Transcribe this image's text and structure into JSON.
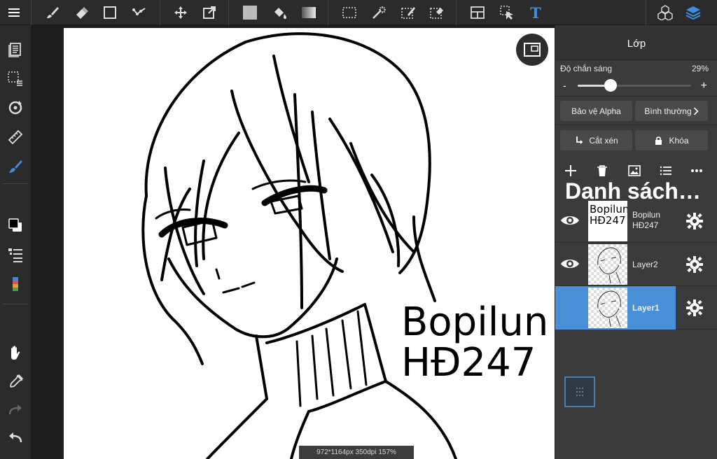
{
  "canvas": {
    "text_lines": [
      "Bopilun",
      "HĐ247"
    ],
    "status": "972*1164px 350dpi 157%"
  },
  "panel": {
    "title": "Lớp",
    "opacity_label": "Độ chắn sáng",
    "opacity_value": "29%",
    "opacity_fraction": 0.29,
    "slider_minus": "-",
    "slider_plus": "+",
    "alpha_lock_label": "Bảo vệ Alpha",
    "blend_mode_label": "Bình thường",
    "clipping_label": "Cắt xén",
    "lock_label": "Khóa",
    "layer_list_title": "Danh sách…",
    "layers": [
      {
        "name": "Bopilun HĐ247",
        "name_lines": [
          "Bopilun",
          "HĐ247"
        ],
        "visible": true,
        "selected": false,
        "thumb_text": [
          "Bopilun",
          "HĐ247"
        ]
      },
      {
        "name": "Layer2",
        "visible": true,
        "selected": false
      },
      {
        "name": "Layer1",
        "visible": false,
        "selected": true
      }
    ]
  },
  "colors": {
    "accent": "#4a90d9",
    "toolbar_icon_blue": "#3d8fe0"
  },
  "icons": {
    "toolbar": [
      "menu-icon",
      "brush-icon",
      "eraser-icon",
      "rectangle-shape-icon",
      "stroke-correction-icon",
      "move-icon",
      "transform-icon",
      "fill-color-icon",
      "bucket-icon",
      "gradient-icon",
      "selection-rect-icon",
      "magic-wand-icon",
      "selection-pen-icon",
      "selection-eraser-icon",
      "panel-layout-icon",
      "select-tool-icon",
      "text-tool-icon",
      "materials-icon",
      "layers-icon"
    ],
    "sidebar": [
      "pages-icon",
      "selection-menu-icon",
      "rotate-icon",
      "ruler-icon",
      "brush-settings-icon",
      "color-swatch-icon",
      "layers-list-icon",
      "color-palette-icon",
      "hand-icon",
      "eyedropper-icon",
      "redo-icon",
      "undo-icon"
    ]
  }
}
